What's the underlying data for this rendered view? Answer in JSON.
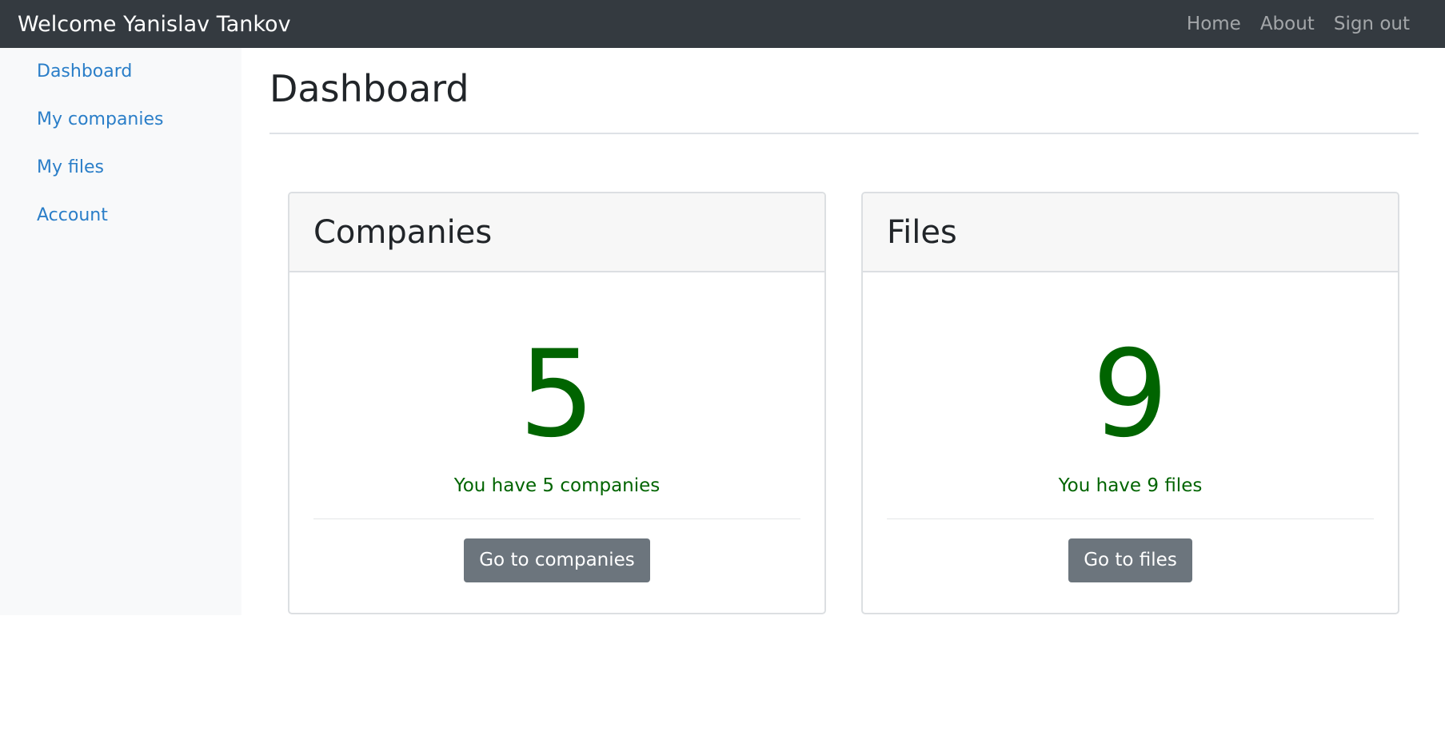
{
  "navbar": {
    "brand": "Welcome Yanislav Tankov",
    "links": [
      "Home",
      "About",
      "Sign out"
    ]
  },
  "sidebar": {
    "items": [
      {
        "label": "Dashboard"
      },
      {
        "label": "My companies"
      },
      {
        "label": "My files"
      },
      {
        "label": "Account"
      }
    ]
  },
  "main": {
    "title": "Dashboard",
    "cards": [
      {
        "title": "Companies",
        "count": "5",
        "description": "You have 5 companies",
        "button": "Go to companies"
      },
      {
        "title": "Files",
        "count": "9",
        "description": "You have 9 files",
        "button": "Go to files"
      }
    ]
  },
  "colors": {
    "navbar_bg": "#343a40",
    "link": "#2a7ec8",
    "success": "#006400",
    "button_bg": "#6c757d"
  }
}
